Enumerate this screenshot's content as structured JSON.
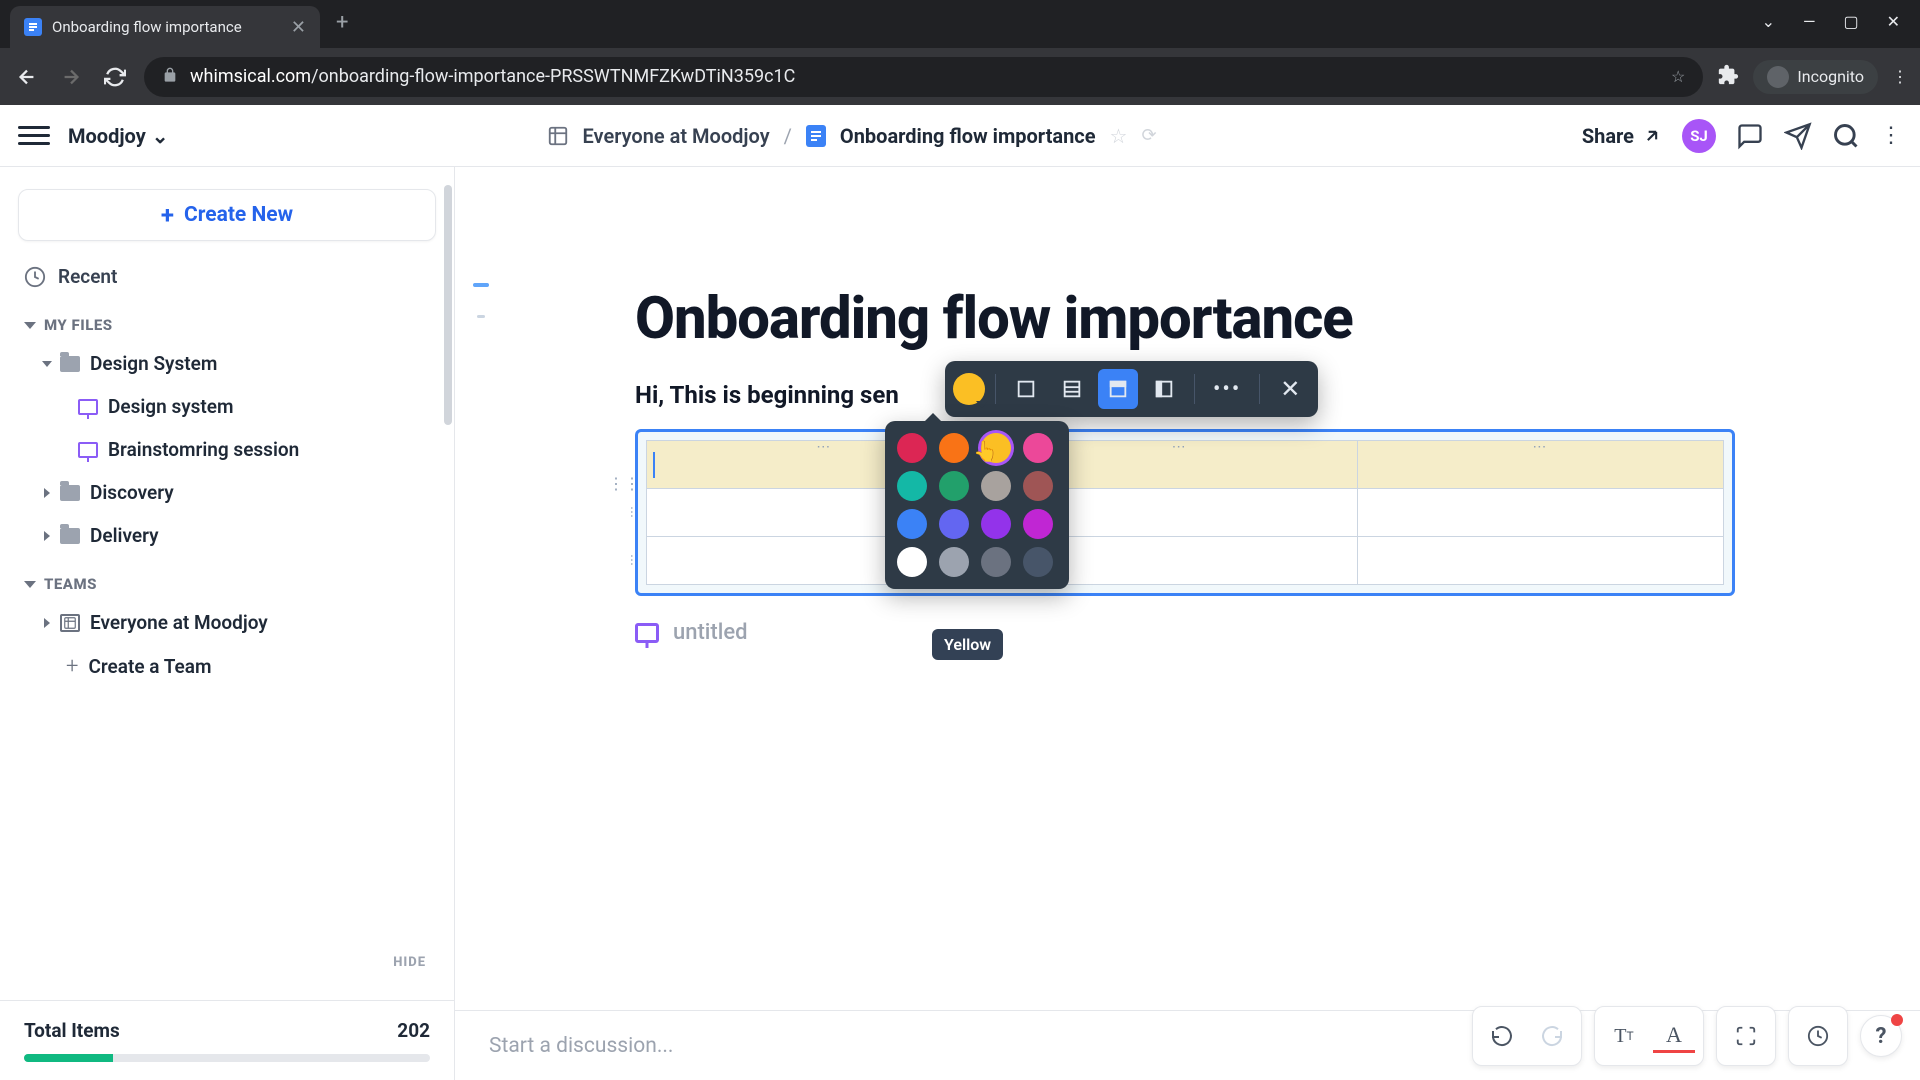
{
  "browser": {
    "tab_title": "Onboarding flow importance",
    "url_domain": "whimsical.com",
    "url_path": "/onboarding-flow-importance-PRSSWTNMFZKwDTiN359c1C",
    "incognito_label": "Incognito"
  },
  "header": {
    "workspace": "Moodjoy",
    "breadcrumb_org": "Everyone at Moodjoy",
    "breadcrumb_doc": "Onboarding flow importance",
    "share_label": "Share",
    "avatar_initials": "SJ"
  },
  "sidebar": {
    "create_label": "Create New",
    "recent_label": "Recent",
    "my_files_label": "MY FILES",
    "teams_label": "TEAMS",
    "hide_label": "HIDE",
    "total_label": "Total Items",
    "total_value": "202",
    "tree": {
      "design_system_folder": "Design System",
      "design_system_doc": "Design system",
      "brainstorming_doc": "Brainstomring session",
      "discovery": "Discovery",
      "delivery": "Delivery",
      "everyone": "Everyone at Moodjoy",
      "create_team": "Create a Team"
    }
  },
  "document": {
    "title": "Onboarding flow importance",
    "body_text": "Hi, This is beginning sen",
    "caption": "untitled"
  },
  "color_picker": {
    "tooltip": "Yellow",
    "colors": [
      {
        "name": "red",
        "hex": "#dc2654"
      },
      {
        "name": "orange",
        "hex": "#f97316"
      },
      {
        "name": "yellow",
        "hex": "#fbbf24"
      },
      {
        "name": "pink",
        "hex": "#ec4899"
      },
      {
        "name": "teal",
        "hex": "#14b8a6"
      },
      {
        "name": "green",
        "hex": "#22a06b"
      },
      {
        "name": "tan",
        "hex": "#a8a29e"
      },
      {
        "name": "mauve",
        "hex": "#9f5555"
      },
      {
        "name": "blue",
        "hex": "#3b82f6"
      },
      {
        "name": "indigo",
        "hex": "#6366f1"
      },
      {
        "name": "purple",
        "hex": "#9333ea"
      },
      {
        "name": "magenta",
        "hex": "#c026d3"
      },
      {
        "name": "white",
        "hex": "#ffffff"
      },
      {
        "name": "light-gray",
        "hex": "#9ca3af"
      },
      {
        "name": "gray",
        "hex": "#6b7280"
      },
      {
        "name": "dark-gray",
        "hex": "#475569"
      }
    ]
  },
  "discussion": {
    "placeholder": "Start a discussion..."
  }
}
